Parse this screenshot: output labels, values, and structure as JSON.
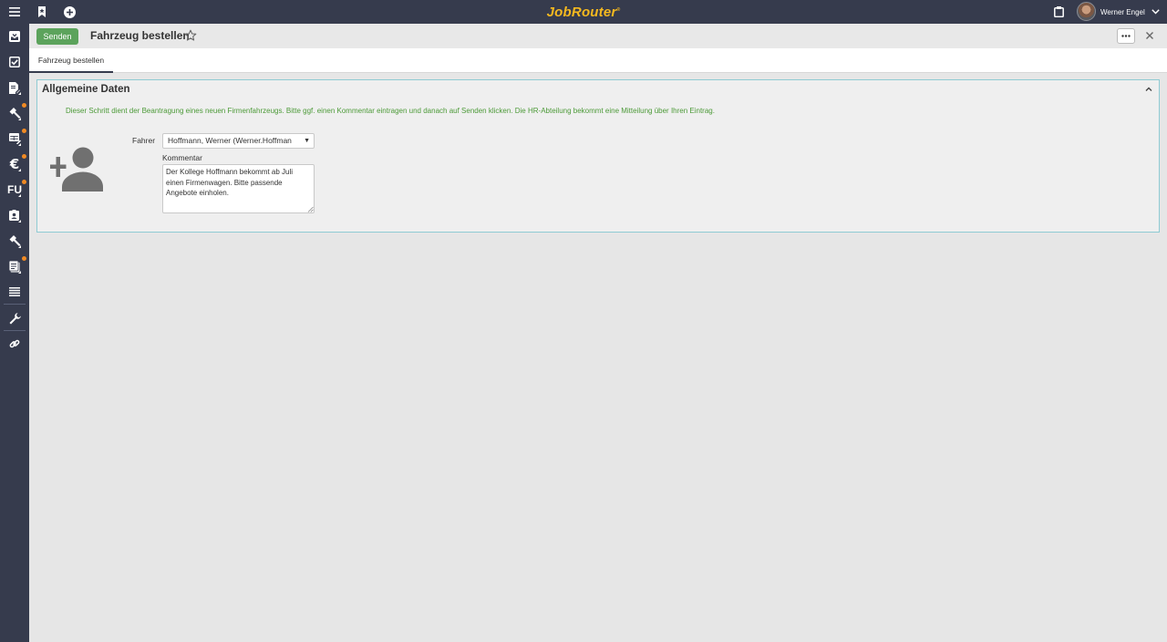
{
  "app": {
    "logo_text": "JobRouter",
    "logo_mark": "®",
    "accent_color": "#f6b91f",
    "sidebar_color": "#363b4d"
  },
  "topbar": {
    "icons": [
      "menu-icon",
      "bookmark-icon",
      "add-circle-icon",
      "clipboard-icon",
      "chevron-down-icon"
    ],
    "user_name": "Werner Engel"
  },
  "sidebar": {
    "items": [
      {
        "icon": "inbox-icon",
        "notification": false
      },
      {
        "icon": "check-box-icon",
        "notification": false
      },
      {
        "icon": "document-edit-icon",
        "notification": false
      },
      {
        "icon": "hammer-icon",
        "notification": true
      },
      {
        "icon": "table-edit-icon",
        "notification": true
      },
      {
        "icon": "euro-icon",
        "notification": true
      },
      {
        "icon": "fu-icon",
        "label": "FU",
        "notification": true
      },
      {
        "icon": "contact-card-icon",
        "notification": false
      },
      {
        "icon": "hammer-icon",
        "notification": false
      },
      {
        "icon": "clipboard-list-icon",
        "notification": true
      },
      {
        "icon": "list-icon",
        "notification": false
      },
      {
        "icon": "wrench-icon",
        "notification": false
      },
      {
        "icon": "link-icon",
        "notification": false
      }
    ]
  },
  "header": {
    "send_label": "Senden",
    "send_color": "#5ca35c",
    "title": "Fahrzeug bestellen",
    "more_label": "···"
  },
  "tabs": [
    {
      "label": "Fahrzeug bestellen",
      "active": true
    }
  ],
  "panel": {
    "title": "Allgemeine Daten",
    "description": "Dieser Schritt dient der Beantragung eines neuen Firmenfahrzeugs. Bitte ggf. einen Kommentar eintragen und danach auf Senden klicken. Die HR-Abteilung bekommt eine Mitteilung über Ihren Eintrag.",
    "description_color": "#4c9a38",
    "border_color": "#8fcbd3",
    "fahrer_label": "Fahrer",
    "fahrer_value": "Hoffmann, Werner (Werner.Hoffman",
    "kommentar_label": "Kommentar",
    "kommentar_value": "Der Kollege Hoffmann bekommt ab Juli einen Firmenwagen. Bitte passende Angebote einholen."
  }
}
